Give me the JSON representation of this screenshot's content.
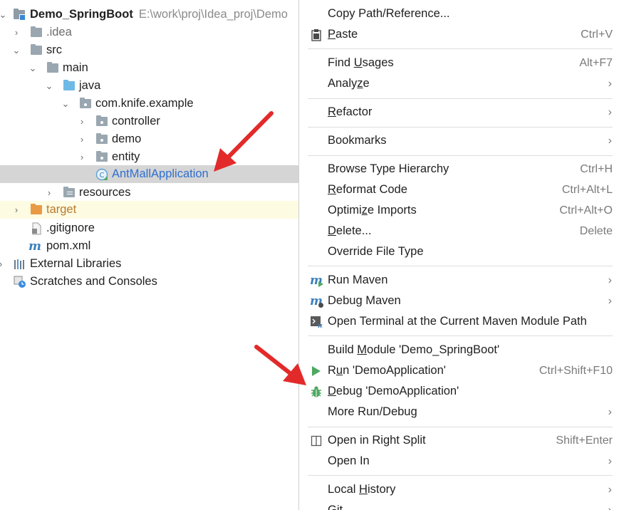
{
  "tree": {
    "project": {
      "name": "Demo_SpringBoot",
      "path": "E:\\work\\proj\\Idea_proj\\Demo"
    },
    "idea": ".idea",
    "src": "src",
    "main": "main",
    "java": "java",
    "package": "com.knife.example",
    "controller": "controller",
    "demo": "demo",
    "entity": "entity",
    "app_class": "AntMallApplication",
    "resources": "resources",
    "target": "target",
    "gitignore": ".gitignore",
    "pom": "pom.xml",
    "external_libraries": "External Libraries",
    "scratches": "Scratches and Consoles"
  },
  "menu": {
    "copy_path": {
      "label": "Copy Path/Reference..."
    },
    "paste": {
      "pre": "",
      "u": "P",
      "post": "aste",
      "shortcut": "Ctrl+V"
    },
    "find_usages": {
      "pre": "Find ",
      "u": "U",
      "post": "sages",
      "shortcut": "Alt+F7"
    },
    "analyze": {
      "pre": "Analy",
      "u": "z",
      "post": "e"
    },
    "refactor": {
      "pre": "",
      "u": "R",
      "post": "efactor"
    },
    "bookmarks": {
      "label": "Bookmarks"
    },
    "browse_hierarchy": {
      "label": "Browse Type Hierarchy",
      "shortcut": "Ctrl+H"
    },
    "reformat": {
      "pre": "",
      "u": "R",
      "post": "eformat Code",
      "shortcut": "Ctrl+Alt+L"
    },
    "optimize": {
      "pre": "Optimi",
      "u": "z",
      "post": "e Imports",
      "shortcut": "Ctrl+Alt+O"
    },
    "delete": {
      "pre": "",
      "u": "D",
      "post": "elete...",
      "shortcut": "Delete"
    },
    "override_type": {
      "label": "Override File Type"
    },
    "run_maven": {
      "label": "Run Maven"
    },
    "debug_maven": {
      "label": "Debug Maven"
    },
    "open_terminal": {
      "label": "Open Terminal at the Current Maven Module Path"
    },
    "build_module": {
      "pre": "Build ",
      "u": "M",
      "post": "odule 'Demo_SpringBoot'"
    },
    "run_app": {
      "pre": "R",
      "u": "u",
      "post": "n 'DemoApplication'",
      "shortcut": "Ctrl+Shift+F10"
    },
    "debug_app": {
      "pre": "",
      "u": "D",
      "post": "ebug 'DemoApplication'"
    },
    "more_run": {
      "label": "More Run/Debug"
    },
    "open_right_split": {
      "label": "Open in Right Split",
      "shortcut": "Shift+Enter"
    },
    "open_in": {
      "label": "Open In"
    },
    "local_history": {
      "pre": "Local ",
      "u": "H",
      "post": "istory"
    },
    "git": {
      "label": "Git"
    }
  },
  "colors": {
    "selection": "#d5d5d5",
    "link_blue": "#2f6fd0",
    "excluded_orange": "#e89a45",
    "folder_gray": "#9aa7b0",
    "source_blue": "#6fb9e6",
    "annotation_red": "#e32a2a",
    "run_green": "#4fa860"
  },
  "icons": {
    "folder": "folder-icon",
    "source_root": "source-folder-icon",
    "package": "package-icon",
    "spring_class": "spring-class-icon",
    "maven": "maven-icon",
    "clipboard": "clipboard-icon",
    "terminal": "terminal-icon",
    "run": "run-icon",
    "debug": "bug-icon",
    "split": "split-icon",
    "scratches": "scratches-icon",
    "libraries": "libraries-icon"
  }
}
